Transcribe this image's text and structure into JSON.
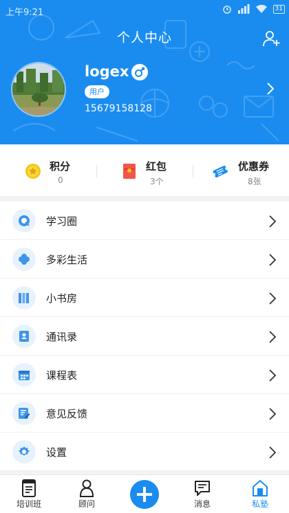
{
  "status_bar": {
    "time": "上午9:21",
    "battery": "31"
  },
  "header": {
    "title": "个人中心"
  },
  "profile": {
    "username": "logex",
    "role": "用户",
    "phone": "15679158128"
  },
  "stats": [
    {
      "label": "积分",
      "value": "0",
      "icon": "coin-star-icon"
    },
    {
      "label": "红包",
      "value": "3个",
      "icon": "red-envelope-icon"
    },
    {
      "label": "优惠券",
      "value": "8张",
      "icon": "coupon-ticket-icon"
    }
  ],
  "menu": [
    {
      "label": "学习圈",
      "icon": "chat-bubble-icon"
    },
    {
      "label": "多彩生活",
      "icon": "clover-icon"
    },
    {
      "label": "小书房",
      "icon": "books-icon"
    },
    {
      "label": "通讯录",
      "icon": "contacts-book-icon"
    },
    {
      "label": "课程表",
      "icon": "calendar-icon"
    },
    {
      "label": "意见反馈",
      "icon": "edit-note-icon"
    },
    {
      "label": "设置",
      "icon": "settings-gear-icon"
    }
  ],
  "tabbar": [
    {
      "label": "培训班",
      "icon": "document-icon",
      "active": false
    },
    {
      "label": "顾问",
      "icon": "person-icon",
      "active": false
    },
    {
      "label": "",
      "icon": "plus-icon",
      "active": false
    },
    {
      "label": "消息",
      "icon": "message-icon",
      "active": false
    },
    {
      "label": "私塾",
      "icon": "home-icon",
      "active": true
    }
  ],
  "colors": {
    "primary": "#1a8cf0",
    "page_bg": "#f2f3f5",
    "coin": "#f5c518",
    "red_envelope": "#f2554a"
  }
}
